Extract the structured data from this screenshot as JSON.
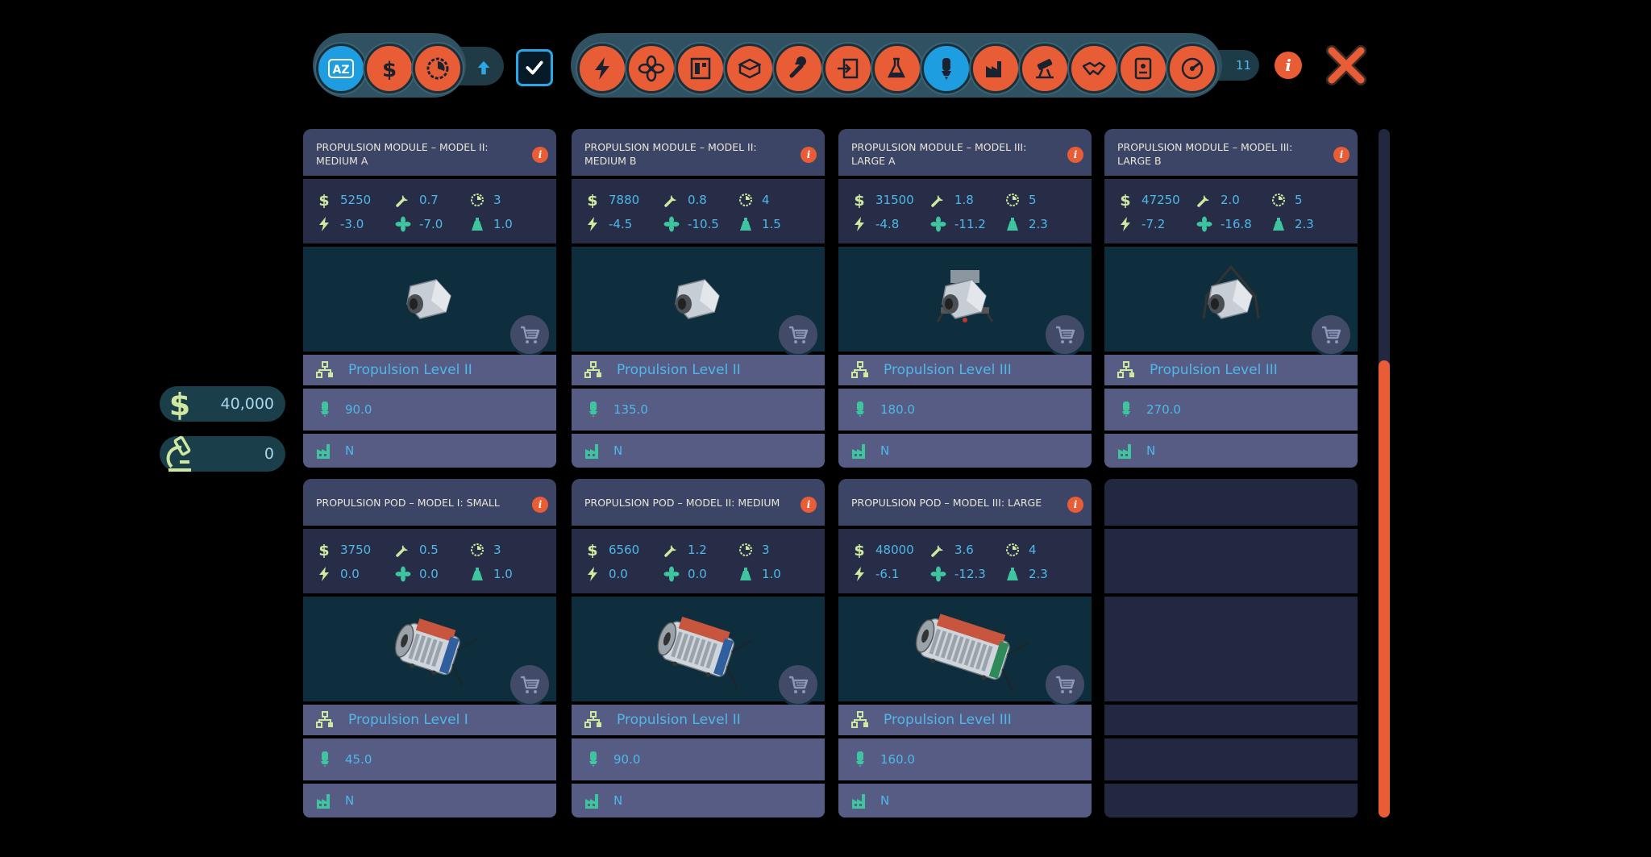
{
  "toolbar": {
    "sort_buttons": [
      {
        "icon": "az-sort-icon",
        "label": "AZ",
        "active": true
      },
      {
        "icon": "dollar-icon",
        "active": false
      },
      {
        "icon": "timer-icon",
        "active": false
      }
    ],
    "sort_direction_icon": "arrow-up-icon",
    "filter_checked": true,
    "categories": [
      {
        "icon": "bolt-icon",
        "active": false
      },
      {
        "icon": "fan-icon",
        "active": false
      },
      {
        "icon": "module-icon",
        "active": false
      },
      {
        "icon": "shield-box-icon",
        "active": false
      },
      {
        "icon": "wrench-icon",
        "active": false
      },
      {
        "icon": "docking-icon",
        "active": false
      },
      {
        "icon": "lab-flask-icon",
        "active": false
      },
      {
        "icon": "propulsion-icon",
        "active": true
      },
      {
        "icon": "factory-icon",
        "active": false
      },
      {
        "icon": "telescope-icon",
        "active": false
      },
      {
        "icon": "handshake-icon",
        "active": false
      },
      {
        "icon": "document-icon",
        "active": false
      },
      {
        "icon": "gauge-icon",
        "active": false
      }
    ],
    "count": "11"
  },
  "resources": {
    "money": "40,000",
    "science": "0"
  },
  "colors": {
    "accent": "#e85d36",
    "active": "#1e9ee0",
    "value_text": "#4fb8e8",
    "card_header": "#3d4566"
  },
  "cards": [
    {
      "title": "PROPULSION MODULE – MODEL II: MEDIUM A",
      "cost": "5250",
      "maint": "0.7",
      "time": "3",
      "power": "-3.0",
      "air": "-7.0",
      "mass": "1.0",
      "tech": "Propulsion Level II",
      "thrust": "90.0",
      "factory": "N",
      "model": "module-small"
    },
    {
      "title": "PROPULSION MODULE – MODEL II: MEDIUM B",
      "cost": "7880",
      "maint": "0.8",
      "time": "4",
      "power": "-4.5",
      "air": "-10.5",
      "mass": "1.5",
      "tech": "Propulsion Level II",
      "thrust": "135.0",
      "factory": "N",
      "model": "module-small"
    },
    {
      "title": "PROPULSION MODULE – MODEL III: LARGE A",
      "cost": "31500",
      "maint": "1.8",
      "time": "5",
      "power": "-4.8",
      "air": "-11.2",
      "mass": "2.3",
      "tech": "Propulsion Level III",
      "thrust": "180.0",
      "factory": "N",
      "model": "module-large-a"
    },
    {
      "title": "PROPULSION MODULE – MODEL III: LARGE B",
      "cost": "47250",
      "maint": "2.0",
      "time": "5",
      "power": "-7.2",
      "air": "-16.8",
      "mass": "2.3",
      "tech": "Propulsion Level III",
      "thrust": "270.0",
      "factory": "N",
      "model": "module-large-b"
    },
    {
      "title": "PROPULSION POD – MODEL I: SMALL",
      "cost": "3750",
      "maint": "0.5",
      "time": "3",
      "power": "0.0",
      "air": "0.0",
      "mass": "1.0",
      "tech": "Propulsion Level I",
      "thrust": "45.0",
      "factory": "N",
      "model": "pod-small"
    },
    {
      "title": "PROPULSION POD – MODEL II: MEDIUM",
      "cost": "6560",
      "maint": "1.2",
      "time": "3",
      "power": "0.0",
      "air": "0.0",
      "mass": "1.0",
      "tech": "Propulsion Level II",
      "thrust": "90.0",
      "factory": "N",
      "model": "pod-medium"
    },
    {
      "title": "PROPULSION POD – MODEL III: LARGE",
      "cost": "48000",
      "maint": "3.6",
      "time": "4",
      "power": "-6.1",
      "air": "-12.3",
      "mass": "2.3",
      "tech": "Propulsion Level III",
      "thrust": "160.0",
      "factory": "N",
      "model": "pod-large"
    }
  ]
}
